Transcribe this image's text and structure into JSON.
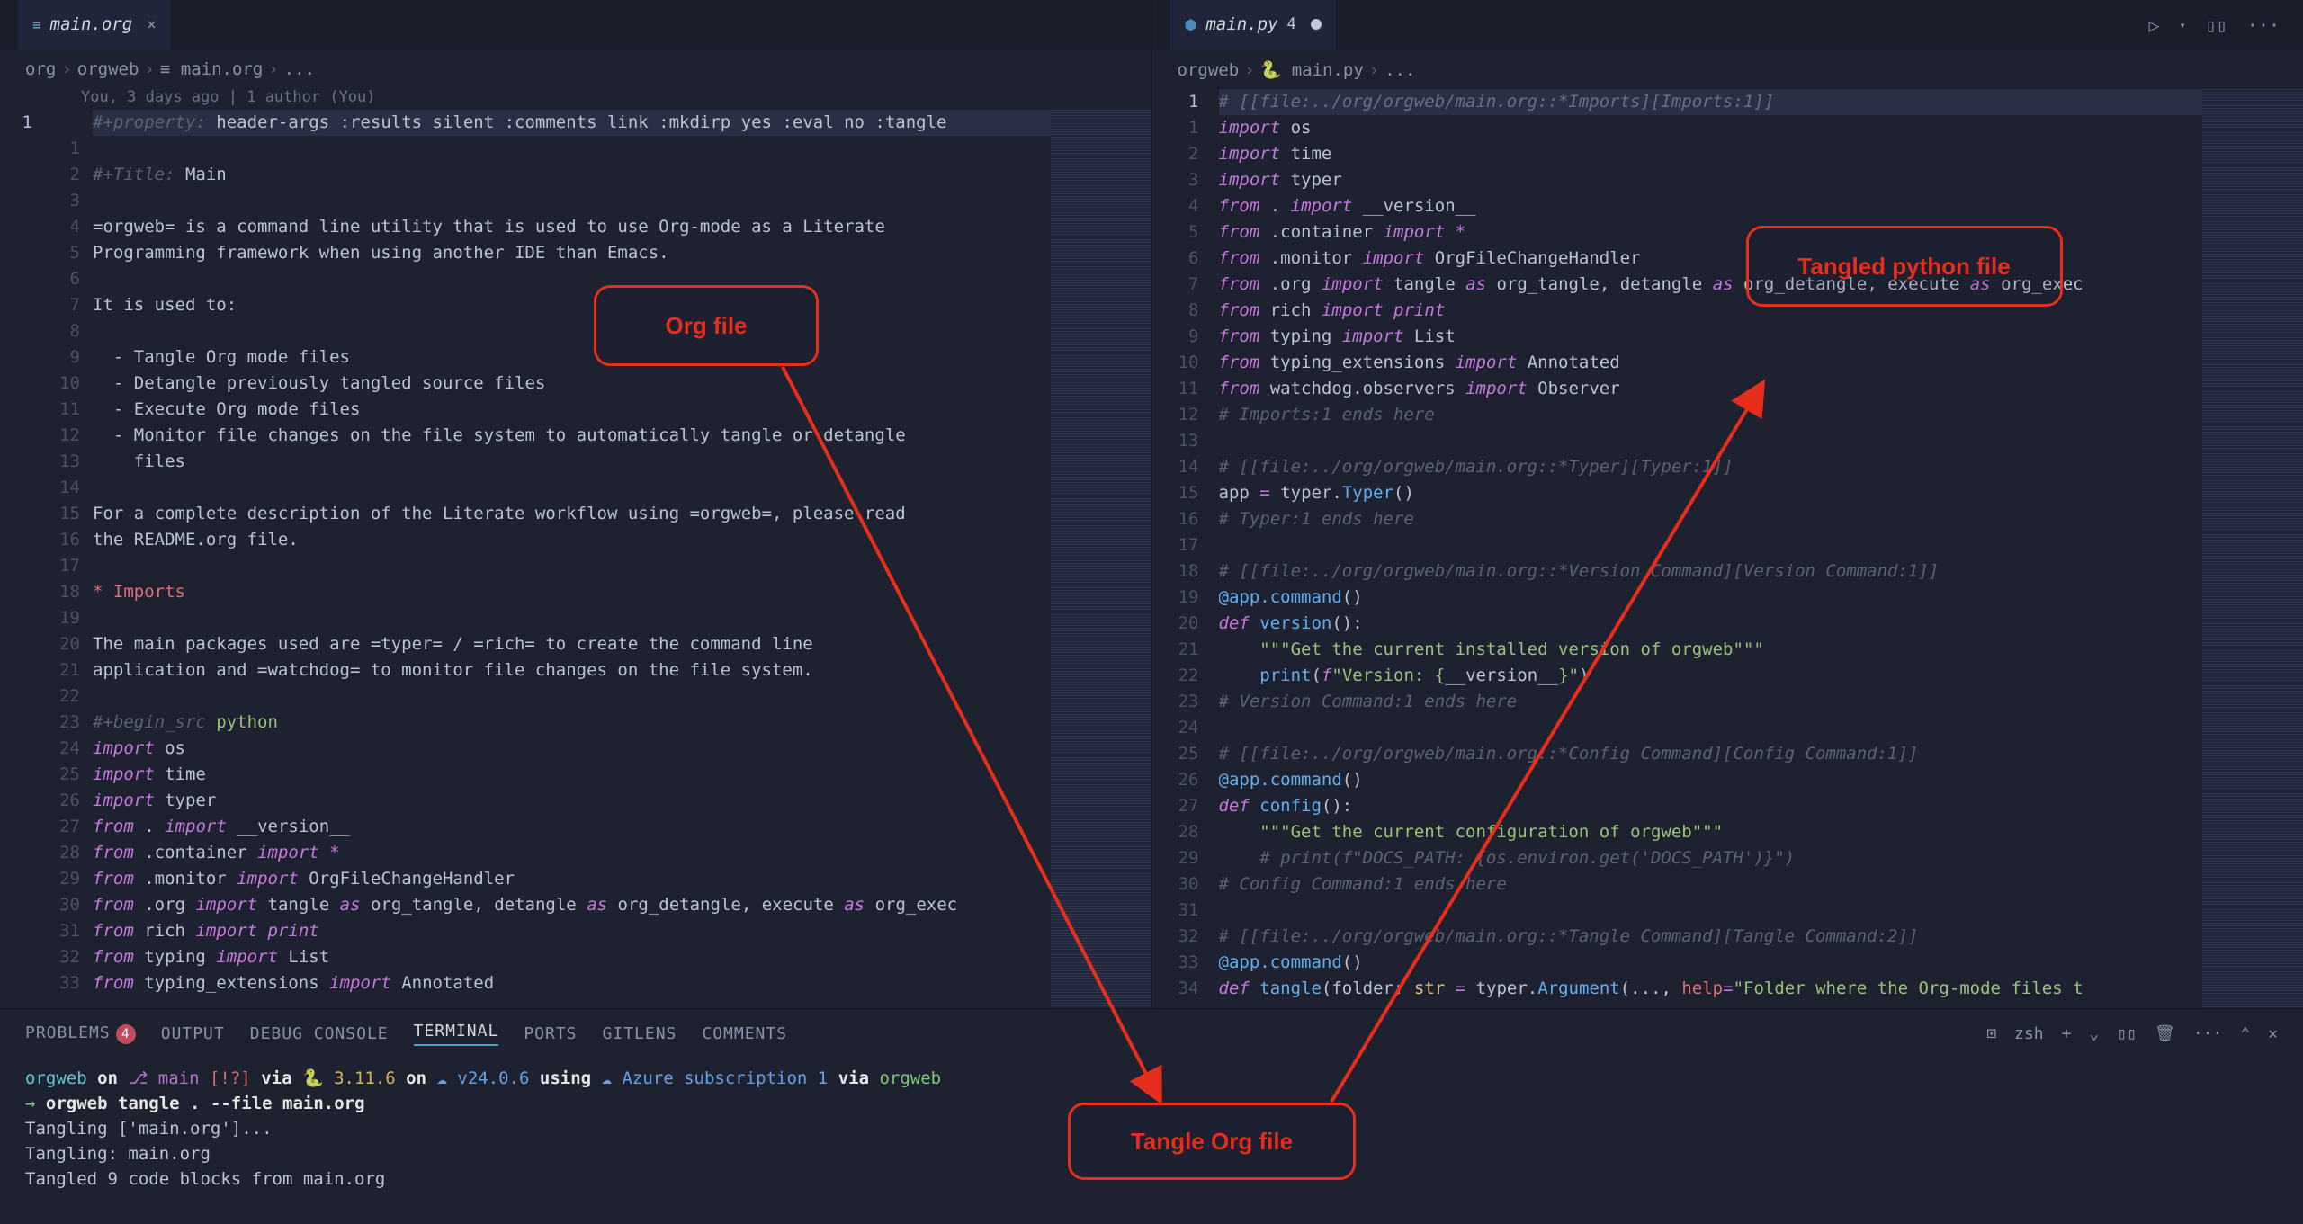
{
  "left_tab": {
    "icon": "≡",
    "name": "main.org"
  },
  "right_tab": {
    "icon": "🐍",
    "name": "main.py",
    "problems": "4"
  },
  "left_breadcrumb": [
    "org",
    "orgweb",
    "≡ main.org",
    "..."
  ],
  "right_breadcrumb": [
    "orgweb",
    "🐍 main.py",
    "..."
  ],
  "codelens": "You, 3 days ago | 1 author (You)",
  "left_lines": [
    {
      "n": "1",
      "sub": "",
      "cls": "current",
      "html": "<span class='c-comment'>#+property:</span> <span class='c-plain'>header-args :results silent :comments link :mkdirp yes :eval no :tangle</span>"
    },
    {
      "n": "",
      "sub": "1",
      "html": ""
    },
    {
      "n": "",
      "sub": "2",
      "html": "<span class='c-comment'>#+Title:</span> <span class='c-plain'>Main</span>"
    },
    {
      "n": "",
      "sub": "3",
      "html": ""
    },
    {
      "n": "",
      "sub": "4",
      "html": "<span class='c-plain'>=orgweb= is a command line utility that is used to use Org-mode as a Literate</span>"
    },
    {
      "n": "",
      "sub": "5",
      "html": "<span class='c-plain'>Programming framework when using another IDE than Emacs.</span>"
    },
    {
      "n": "",
      "sub": "6",
      "html": ""
    },
    {
      "n": "",
      "sub": "7",
      "html": "<span class='c-plain'>It is used to:</span>"
    },
    {
      "n": "",
      "sub": "8",
      "html": ""
    },
    {
      "n": "",
      "sub": "9",
      "html": "  <span class='c-plain'>- Tangle Org mode files</span>"
    },
    {
      "n": "",
      "sub": "10",
      "html": "  <span class='c-plain'>- Detangle previously tangled source files</span>"
    },
    {
      "n": "",
      "sub": "11",
      "html": "  <span class='c-plain'>- Execute Org mode files</span>"
    },
    {
      "n": "",
      "sub": "12",
      "html": "  <span class='c-plain'>- Monitor file changes on the file system to automatically tangle or detangle</span>"
    },
    {
      "n": "",
      "sub": "13",
      "html": "    <span class='c-plain'>files</span>"
    },
    {
      "n": "",
      "sub": "14",
      "html": ""
    },
    {
      "n": "",
      "sub": "15",
      "html": "<span class='c-plain'>For a complete description of the Literate workflow using =orgweb=, please read</span>"
    },
    {
      "n": "",
      "sub": "16",
      "html": "<span class='c-plain'>the README.org file.</span>"
    },
    {
      "n": "",
      "sub": "17",
      "html": ""
    },
    {
      "n": "",
      "sub": "18",
      "html": "<span class='c-heading'>* Imports</span>"
    },
    {
      "n": "",
      "sub": "19",
      "html": ""
    },
    {
      "n": "",
      "sub": "20",
      "html": "<span class='c-plain'>The main packages used are =typer= / =rich= to create the command line</span>"
    },
    {
      "n": "",
      "sub": "21",
      "html": "<span class='c-plain'>application and =watchdog= to monitor file changes on the file system.</span>"
    },
    {
      "n": "",
      "sub": "22",
      "html": ""
    },
    {
      "n": "",
      "sub": "23",
      "html": "<span class='c-comment'>#+begin_src</span> <span class='c-str'>python</span>"
    },
    {
      "n": "",
      "sub": "24",
      "html": "<span class='c-kw'>import</span> <span class='c-plain'>os</span>"
    },
    {
      "n": "",
      "sub": "25",
      "html": "<span class='c-kw'>import</span> <span class='c-plain'>time</span>"
    },
    {
      "n": "",
      "sub": "26",
      "html": "<span class='c-kw'>import</span> <span class='c-plain'>typer</span>"
    },
    {
      "n": "",
      "sub": "27",
      "html": "<span class='c-kw'>from</span> <span class='c-plain'>.</span> <span class='c-kw'>import</span> <span class='c-plain'>__version__</span>"
    },
    {
      "n": "",
      "sub": "28",
      "html": "<span class='c-kw'>from</span> <span class='c-plain'>.container</span> <span class='c-kw'>import</span> <span class='c-op'>*</span>"
    },
    {
      "n": "",
      "sub": "29",
      "html": "<span class='c-kw'>from</span> <span class='c-plain'>.monitor</span> <span class='c-kw'>import</span> <span class='c-plain'>OrgFileChangeHandler</span>"
    },
    {
      "n": "",
      "sub": "30",
      "html": "<span class='c-kw'>from</span> <span class='c-plain'>.org</span> <span class='c-kw'>import</span> <span class='c-plain'>tangle</span> <span class='c-kw'>as</span> <span class='c-plain'>org_tangle, detangle</span> <span class='c-kw'>as</span> <span class='c-plain'>org_detangle, execute</span> <span class='c-kw'>as</span> <span class='c-plain'>org_exec</span>"
    },
    {
      "n": "",
      "sub": "31",
      "html": "<span class='c-kw'>from</span> <span class='c-plain'>rich</span> <span class='c-kw'>import</span> <span class='c-kw'>print</span>"
    },
    {
      "n": "",
      "sub": "32",
      "html": "<span class='c-kw'>from</span> <span class='c-plain'>typing</span> <span class='c-kw'>import</span> <span class='c-plain'>List</span>"
    },
    {
      "n": "",
      "sub": "33",
      "html": "<span class='c-kw'>from</span> <span class='c-plain'>typing_extensions</span> <span class='c-kw'>import</span> <span class='c-plain'>Annotated</span>"
    }
  ],
  "right_lines": [
    {
      "n": "1",
      "cls": "current",
      "html": "<span class='c-link'># [[file:../org/orgweb/main.org::*Imports][Imports:1]]</span>"
    },
    {
      "n": "1",
      "html": "<span class='c-kw'>import</span> <span class='c-plain'>os</span>"
    },
    {
      "n": "2",
      "html": "<span class='c-kw'>import</span> <span class='c-plain'>time</span>"
    },
    {
      "n": "3",
      "html": "<span class='c-kw'>import</span> <span class='c-plain'>typer</span>"
    },
    {
      "n": "4",
      "html": "<span class='c-kw'>from</span> <span class='c-plain'>.</span> <span class='c-kw'>import</span> <span class='c-plain'>__version__</span>"
    },
    {
      "n": "5",
      "html": "<span class='c-kw'>from</span> <span class='c-plain'>.container</span> <span class='c-kw'>import</span> <span class='c-op'>*</span>"
    },
    {
      "n": "6",
      "html": "<span class='c-kw'>from</span> <span class='c-plain'>.monitor</span> <span class='c-kw'>import</span> <span class='c-plain'>OrgFileChangeHandler</span>"
    },
    {
      "n": "7",
      "html": "<span class='c-kw'>from</span> <span class='c-plain'>.org</span> <span class='c-kw'>import</span> <span class='c-plain'>tangle</span> <span class='c-kw'>as</span> <span class='c-plain'>org_tangle, detangle</span> <span class='c-kw'>as</span> <span class='c-plain'>org_detangle, execute</span> <span class='c-kw'>as</span> <span class='c-plain'>org_exec</span>"
    },
    {
      "n": "8",
      "html": "<span class='c-kw'>from</span> <span class='c-plain'>rich</span> <span class='c-kw'>import</span> <span class='c-kw'>print</span>"
    },
    {
      "n": "9",
      "html": "<span class='c-kw'>from</span> <span class='c-plain'>typing</span> <span class='c-kw'>import</span> <span class='c-plain'>List</span>"
    },
    {
      "n": "10",
      "html": "<span class='c-kw'>from</span> <span class='c-plain'>typing_extensions</span> <span class='c-kw'>import</span> <span class='c-plain'>Annotated</span>"
    },
    {
      "n": "11",
      "html": "<span class='c-kw'>from</span> <span class='c-plain'>watchdog.observers</span> <span class='c-kw'>import</span> <span class='c-plain'>Observer</span>"
    },
    {
      "n": "12",
      "html": "<span class='c-comment'># Imports:1 ends here</span>"
    },
    {
      "n": "13",
      "html": ""
    },
    {
      "n": "14",
      "html": "<span class='c-comment'># [[file:../org/orgweb/main.org::*Typer][Typer:1]]</span>"
    },
    {
      "n": "15",
      "html": "<span class='c-plain'>app</span> <span class='c-op'>=</span> <span class='c-plain'>typer.</span><span class='c-fn'>Typer</span><span class='c-plain'>()</span>"
    },
    {
      "n": "16",
      "html": "<span class='c-comment'># Typer:1 ends here</span>"
    },
    {
      "n": "17",
      "html": ""
    },
    {
      "n": "18",
      "html": "<span class='c-comment'># [[file:../org/orgweb/main.org::*Version Command][Version Command:1]]</span>"
    },
    {
      "n": "19",
      "html": "<span class='c-deco'>@app.command</span><span class='c-plain'>()</span>"
    },
    {
      "n": "20",
      "html": "<span class='c-kw'>def</span> <span class='c-fn'>version</span><span class='c-plain'>():</span>"
    },
    {
      "n": "21",
      "html": "    <span class='c-str'>\"\"\"Get the current installed version of orgweb\"\"\"</span>"
    },
    {
      "n": "22",
      "html": "    <span class='c-fn'>print</span><span class='c-plain'>(</span><span class='c-kw'>f</span><span class='c-str'>\"Version: {</span><span class='c-plain'>__version__</span><span class='c-str'>}\"</span><span class='c-plain'>)</span>"
    },
    {
      "n": "23",
      "html": "<span class='c-comment'># Version Command:1 ends here</span>"
    },
    {
      "n": "24",
      "html": ""
    },
    {
      "n": "25",
      "html": "<span class='c-comment'># [[file:../org/orgweb/main.org::*Config Command][Config Command:1]]</span>"
    },
    {
      "n": "26",
      "html": "<span class='c-deco'>@app.command</span><span class='c-plain'>()</span>"
    },
    {
      "n": "27",
      "html": "<span class='c-kw'>def</span> <span class='c-fn'>config</span><span class='c-plain'>():</span>"
    },
    {
      "n": "28",
      "html": "    <span class='c-str'>\"\"\"Get the current configuration of orgweb\"\"\"</span>"
    },
    {
      "n": "29",
      "html": "    <span class='c-comment'># print(f\"DOCS_PATH: {os.environ.get('DOCS_PATH')}\")</span>"
    },
    {
      "n": "30",
      "html": "<span class='c-comment'># Config Command:1 ends here</span>"
    },
    {
      "n": "31",
      "html": ""
    },
    {
      "n": "32",
      "html": "<span class='c-comment'># [[file:../org/orgweb/main.org::*Tangle Command][Tangle Command:2]]</span>"
    },
    {
      "n": "33",
      "html": "<span class='c-deco'>@app.command</span><span class='c-plain'>()</span>"
    },
    {
      "n": "34",
      "html": "<span class='c-kw'>def</span> <span class='c-fn'>tangle</span><span class='c-plain'>(folder: </span><span class='c-self'>str</span> <span class='c-op'>=</span> <span class='c-plain'>typer.</span><span class='c-fn'>Argument</span><span class='c-plain'>(..., </span><span class='c-var'>help</span><span class='c-op'>=</span><span class='c-str'>\"Folder where the Org-mode files t</span>"
    }
  ],
  "panel": {
    "tabs": [
      "PROBLEMS",
      "OUTPUT",
      "DEBUG CONSOLE",
      "TERMINAL",
      "PORTS",
      "GITLENS",
      "COMMENTS"
    ],
    "problems_count": "4",
    "active": "TERMINAL",
    "shell": "zsh"
  },
  "terminal_lines": [
    "<span class='term-cyan'>orgweb</span> <span class='term-white'>on</span> <span class='term-mag'>⎇ main</span> <span class='term-red'>[!?]</span> <span class='term-white'>via</span> <span class='term-yellow'>🐍 3.11.6</span> <span class='term-white'>on</span> <span class='term-blue'>☁ v24.0.6</span> <span class='term-white'>using</span> <span class='term-blue'>☁ Azure subscription 1</span> <span class='term-white'>via</span> <span class='term-green'>orgweb</span>",
    "<span class='term-green'>→</span> <span class='term-white'>orgweb tangle . --file main.org</span>",
    "<span class='c-plain'>Tangling ['main.org']...</span>",
    "<span class='c-plain'>Tangling: main.org</span>",
    "<span class='c-plain'>Tangled 9 code blocks from main.org</span>"
  ],
  "annotations": {
    "org_file": "Org file",
    "tangled_py": "Tangled python file",
    "tangle_cmd": "Tangle Org file"
  },
  "actions": {
    "run": "▷",
    "split": "▯▯",
    "more": "···",
    "terminal_launch": "⊡",
    "plus": "+",
    "chevron": "⌄",
    "split2": "▯▯",
    "trash": "🗑",
    "up": "⌃",
    "close": "✕"
  }
}
